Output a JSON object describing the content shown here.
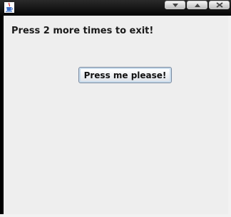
{
  "window": {
    "title": "",
    "app_icon": "java-cup-icon"
  },
  "title_controls": [
    "minimize-icon",
    "maximize-icon",
    "close-icon"
  ],
  "main": {
    "message": "Press 2 more times to exit!",
    "button_label": "Press me please!"
  },
  "colors": {
    "titlebar": "#000000",
    "panel_background": "#eeeeee",
    "button_border": "#7a8aa0",
    "button_focus_ring": "#c9dcec"
  }
}
